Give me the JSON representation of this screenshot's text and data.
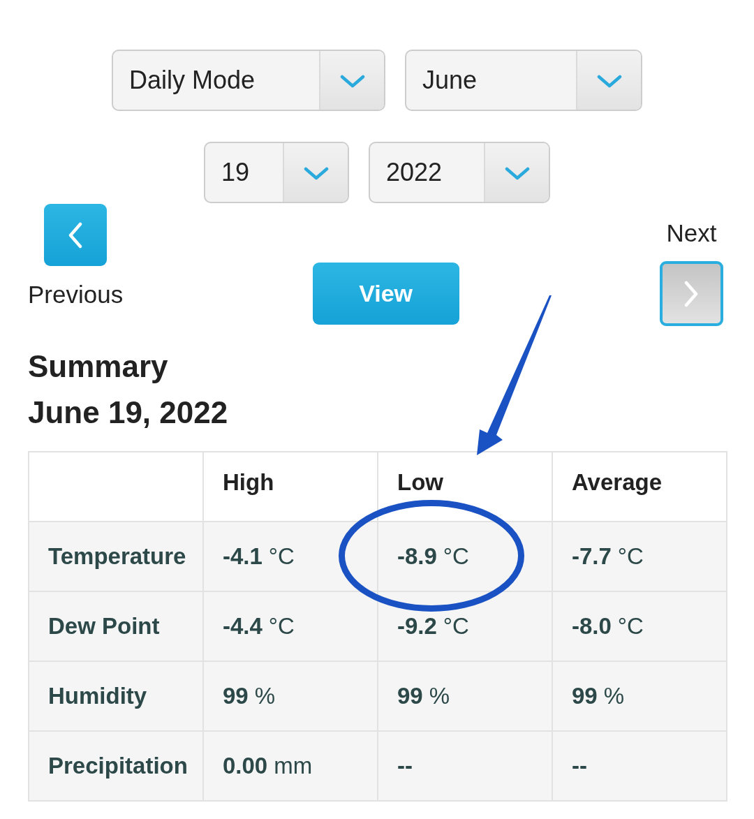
{
  "filter_rows": [
    {
      "dropdowns": [
        {
          "kind": "mode",
          "value": "Daily Mode"
        },
        {
          "kind": "month",
          "value": "June"
        }
      ]
    },
    {
      "dropdowns": [
        {
          "kind": "day",
          "value": "19"
        },
        {
          "kind": "year",
          "value": "2022"
        }
      ]
    }
  ],
  "navigation": {
    "previous": {
      "label": "Previous",
      "disabled": false,
      "focused": false
    },
    "view": {
      "label": "View"
    },
    "next": {
      "label": "Next",
      "disabled": true,
      "focused": true
    }
  },
  "summary": {
    "title": "Summary",
    "date": "June 19, 2022"
  },
  "table": {
    "columns": [
      {
        "label": "High",
        "arrow": false
      },
      {
        "label": "Low",
        "arrow": true
      },
      {
        "label": "Average",
        "arrow": false
      }
    ],
    "rows": [
      {
        "label": "Temperature",
        "cells": [
          {
            "value": "-4.1",
            "unit": "°C",
            "circled": false
          },
          {
            "value": "-8.9",
            "unit": "°C",
            "circled": true
          },
          {
            "value": "-7.7",
            "unit": "°C",
            "circled": false
          }
        ]
      },
      {
        "label": "Dew Point",
        "cells": [
          {
            "value": "-4.4",
            "unit": "°C",
            "circled": false
          },
          {
            "value": "-9.2",
            "unit": "°C",
            "circled": false
          },
          {
            "value": "-8.0",
            "unit": "°C",
            "circled": false
          }
        ]
      },
      {
        "label": "Humidity",
        "cells": [
          {
            "value": "99",
            "unit": "%",
            "circled": false
          },
          {
            "value": "99",
            "unit": "%",
            "circled": false
          },
          {
            "value": "99",
            "unit": "%",
            "circled": false
          }
        ]
      },
      {
        "label": "Precipitation",
        "cells": [
          {
            "value": "0.00",
            "unit": "mm",
            "circled": false
          },
          {
            "value": "--",
            "circled": false
          },
          {
            "value": "--",
            "circled": false
          }
        ]
      }
    ]
  }
}
